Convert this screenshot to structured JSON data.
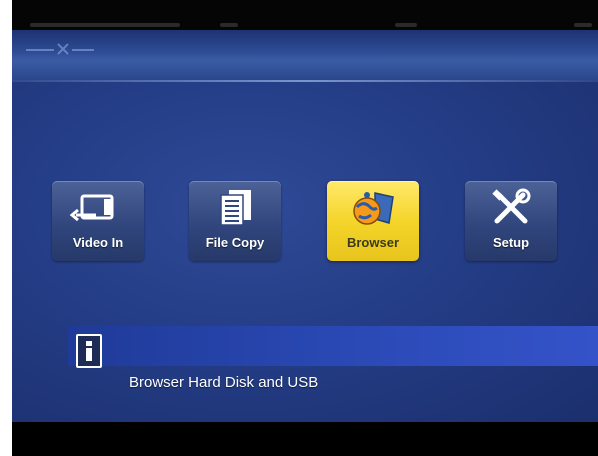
{
  "menu": {
    "items": [
      {
        "label": "Video In",
        "icon": "video-in-icon",
        "selected": false
      },
      {
        "label": "File Copy",
        "icon": "file-copy-icon",
        "selected": false
      },
      {
        "label": "Browser",
        "icon": "browser-globe-icon",
        "selected": true
      },
      {
        "label": "Setup",
        "icon": "setup-tools-icon",
        "selected": false
      }
    ]
  },
  "info_bar": {
    "icon": "info-icon",
    "text": "Browser Hard Disk and USB"
  },
  "colors": {
    "background_blue": "#243d86",
    "selected_tile": "#f4d52a",
    "tile_blue": "#30467d",
    "info_bar_blue": "#2c4bb8"
  }
}
